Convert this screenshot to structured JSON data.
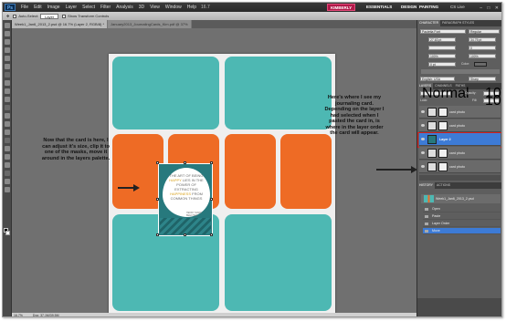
{
  "menubar": {
    "logo": "Ps",
    "items": [
      "File",
      "Edit",
      "Image",
      "Layer",
      "Select",
      "Filter",
      "Analysis",
      "3D",
      "View",
      "Window",
      "Help"
    ],
    "zoom": "16.7",
    "workspaces": [
      "KIMBERLY",
      "ESSENTIALS",
      "DESIGN",
      "PAINTING"
    ],
    "cslive": "CS Live",
    "window_controls": "– □ ✕"
  },
  "options": {
    "auto_select_label": "Auto-Select:",
    "auto_select_value": "Layer",
    "transform_label": "Show Transform Controls"
  },
  "doc_tabs": [
    "Week1_Jan6_2013_2.psd @ 16.7% (Layer 2, RGB/8) *",
    "January2013_JournalingCards_Kim.pdf @ 37%"
  ],
  "annotations": {
    "left": "Now that the card is here, I can adjust it's size, clip it to one of the masks, move it around in the layers palette.",
    "right": "Here's where I see my journaling card. Depending on the layer I had selected when I pasted the card in, is where in the layer order the card will appear."
  },
  "card": {
    "text_plain_1": "THE ART OF BEING",
    "text_highlight_1": "HAPPY",
    "text_plain_2": "LIES IN THE POWER OF EXTRACTING",
    "text_highlight_2": "HAPPINESS",
    "text_plain_3": "FROM COMMON THINGS",
    "signature": "HENRY WARD BEECHER"
  },
  "status": {
    "zoom": "16.7%",
    "doc": "Doc: 37.1M/39.5M"
  },
  "character_panel": {
    "tabs": [
      "CHARACTER",
      "PARAGRAPH STYLES"
    ],
    "font": "Pauletta Font",
    "style": "Regular",
    "size": "27.63 pt",
    "leading": "34.75 pt",
    "tracking": "0",
    "vscale": "100%",
    "hscale": "100%",
    "baseline": "0 pt",
    "color_label": "Color:",
    "lang": "English: USA",
    "aa": "Sharp"
  },
  "layers_panel": {
    "tabs": [
      "LAYERS",
      "CHANNELS",
      "PATHS"
    ],
    "blend_mode": "Normal",
    "opacity_label": "Opacity:",
    "opacity": "100%",
    "fill_label": "Fill:",
    "fill": "100%",
    "lock_label": "Lock:",
    "layers": [
      {
        "name": "card photo",
        "selected": false
      },
      {
        "name": "card photo",
        "selected": false
      },
      {
        "name": "Layer 2",
        "selected": true
      },
      {
        "name": "card photo",
        "selected": false
      },
      {
        "name": "card photo",
        "selected": false
      }
    ]
  },
  "history_panel": {
    "tabs": [
      "HISTORY",
      "ACTIONS"
    ],
    "snapshot": "Week1_Jan6_2013_2.psd",
    "steps": [
      "Open",
      "Paste",
      "Layer Order",
      "Move"
    ],
    "selected_step": "Move"
  },
  "colors": {
    "teal": "#4db8b3",
    "orange": "#ee6b25",
    "selection": "#3d7bd6",
    "highlight": "#d62020"
  }
}
